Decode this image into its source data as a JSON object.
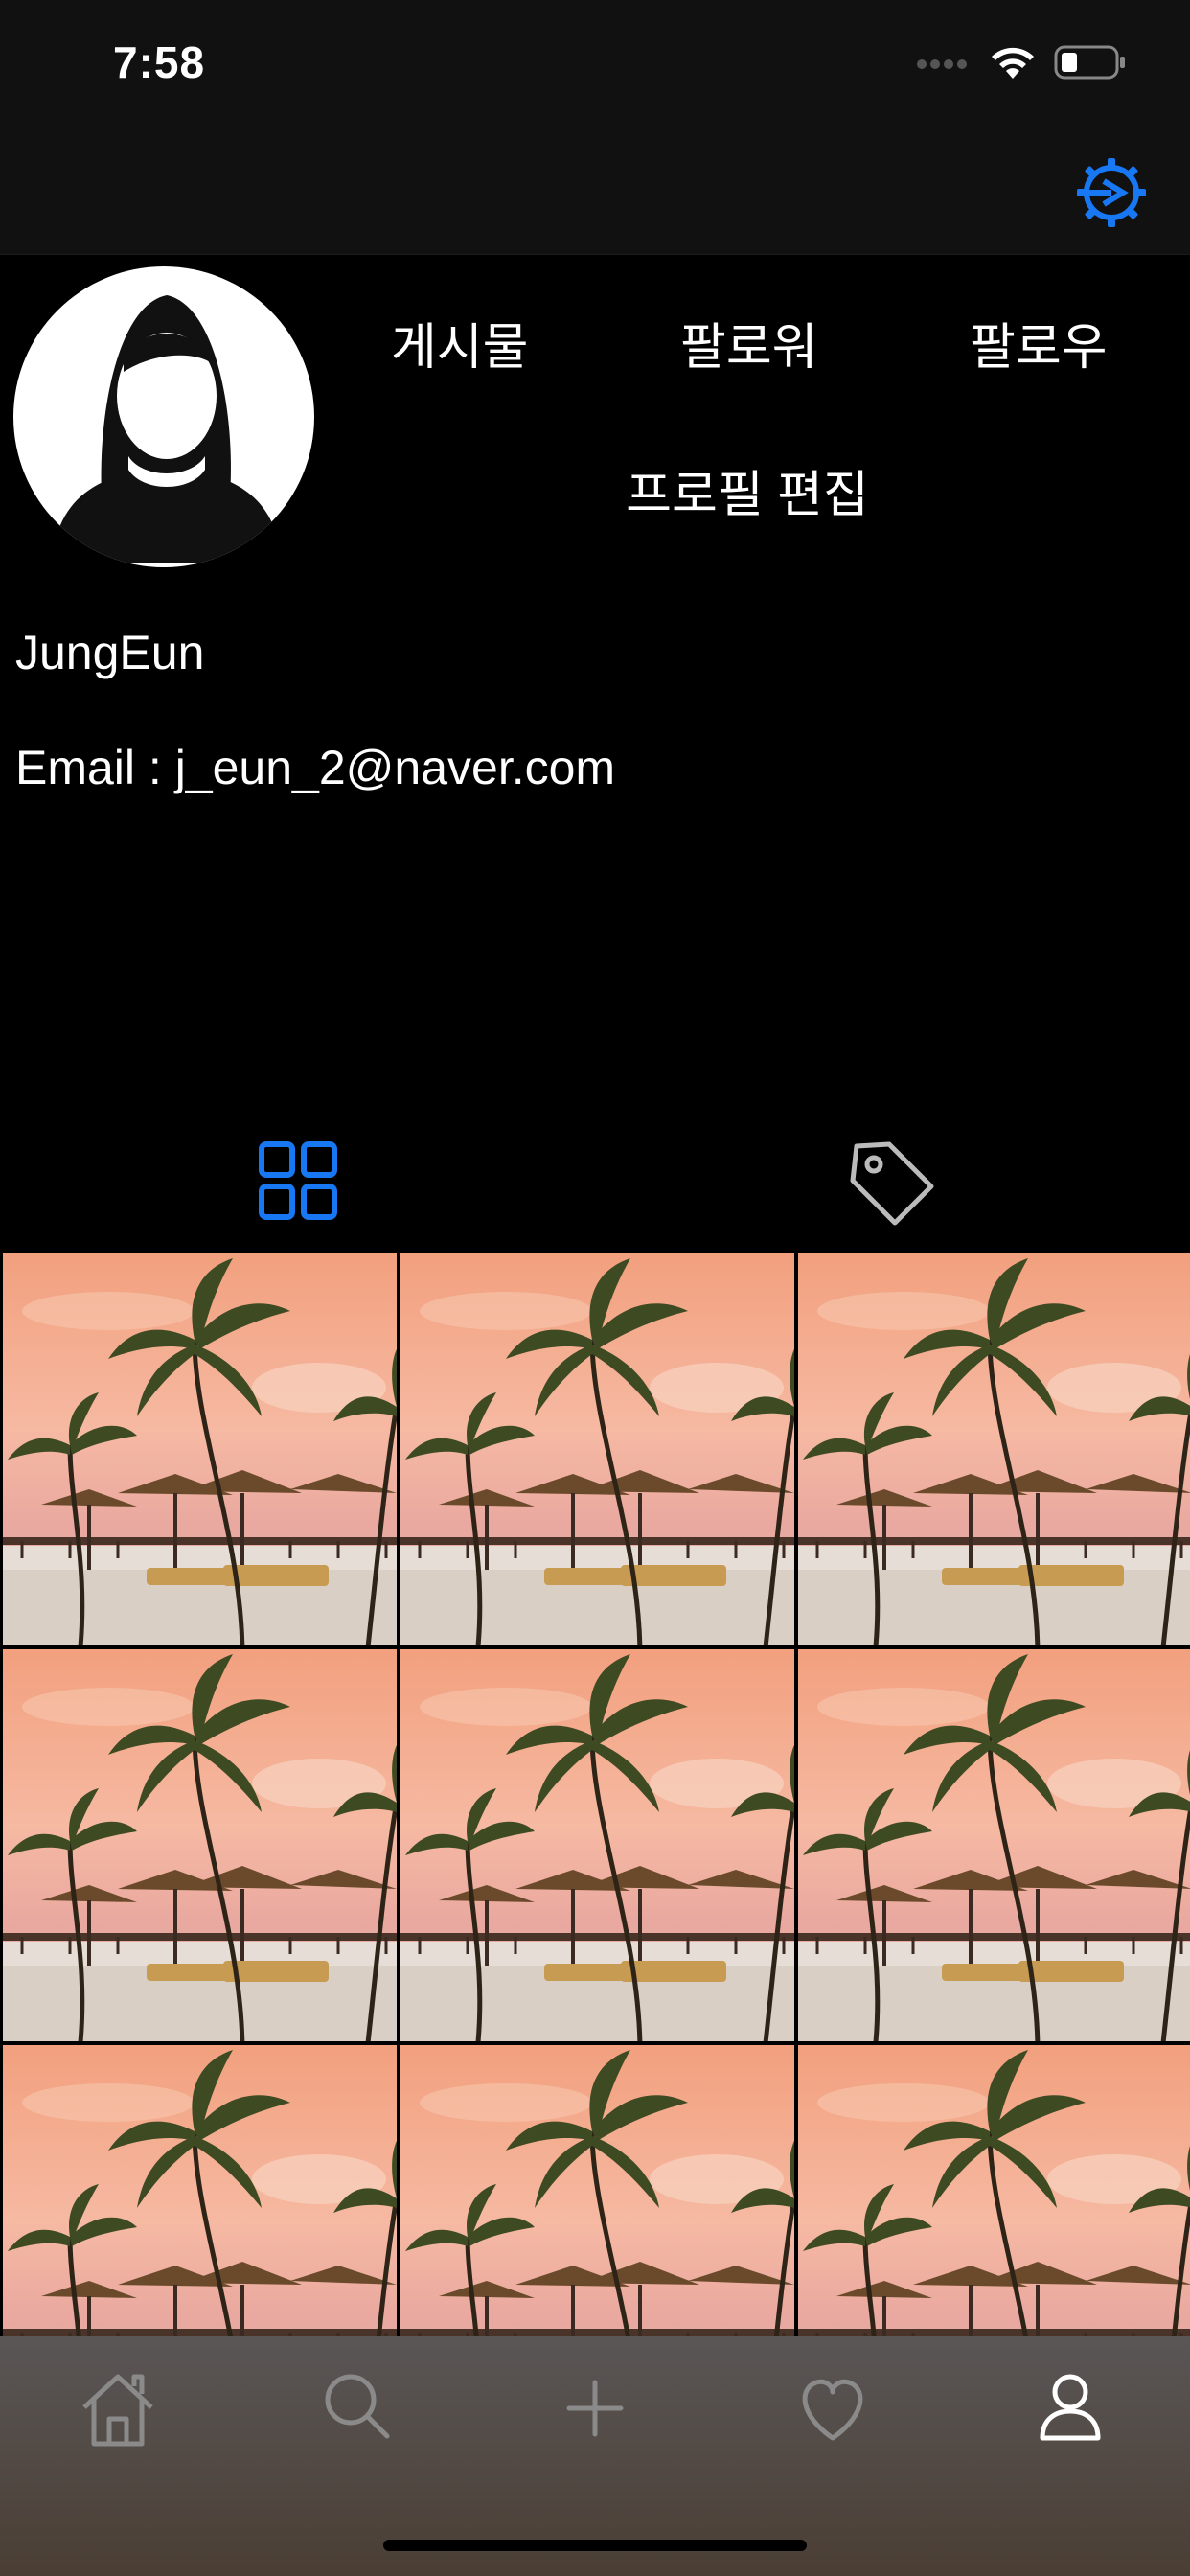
{
  "status_bar": {
    "time": "7:58",
    "icons": [
      "signal-icon",
      "wifi-icon",
      "battery-icon"
    ]
  },
  "nav": {
    "settings_icon": "gear-icon",
    "accent_color": "#1877f2"
  },
  "profile": {
    "avatar_icon": "user-silhouette-icon",
    "stats": {
      "posts_label": "게시물",
      "followers_label": "팔로워",
      "following_label": "팔로우"
    },
    "edit_label": "프로필 편집",
    "username": "JungEun",
    "email": "Email : j_eun_2@naver.com"
  },
  "tabs": {
    "items": [
      {
        "icon": "grid-icon",
        "selected": true
      },
      {
        "icon": "tag-icon",
        "selected": false
      }
    ]
  },
  "posts": {
    "count_visible": 9,
    "image_subject": "beach-palm-sunset-photo"
  },
  "tabbar": {
    "items": [
      {
        "icon": "home-icon",
        "selected": false
      },
      {
        "icon": "search-icon",
        "selected": false
      },
      {
        "icon": "plus-icon",
        "selected": false
      },
      {
        "icon": "heart-icon",
        "selected": false
      },
      {
        "icon": "person-icon",
        "selected": true
      }
    ]
  }
}
